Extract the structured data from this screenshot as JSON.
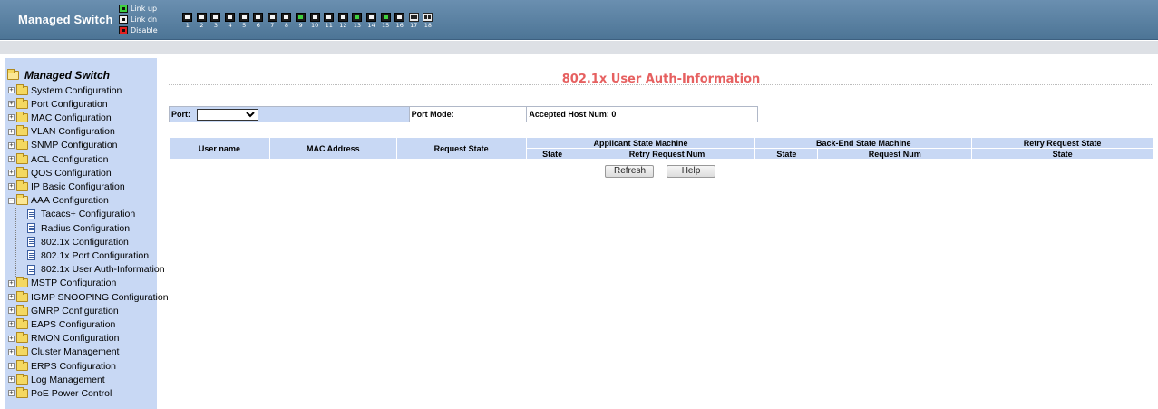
{
  "header": {
    "title": "Managed Switch",
    "legend": [
      {
        "label": "Link up",
        "icon": "port-link-up-icon"
      },
      {
        "label": "Link dn",
        "icon": "port-link-down-icon"
      },
      {
        "label": "Disable",
        "icon": "port-disabled-icon"
      }
    ],
    "ports": [
      {
        "num": "1",
        "type": "copper",
        "up": false
      },
      {
        "num": "2",
        "type": "copper",
        "up": false
      },
      {
        "num": "3",
        "type": "copper",
        "up": false
      },
      {
        "num": "4",
        "type": "copper",
        "up": false
      },
      {
        "num": "5",
        "type": "copper",
        "up": false
      },
      {
        "num": "6",
        "type": "copper",
        "up": false
      },
      {
        "num": "7",
        "type": "copper",
        "up": false
      },
      {
        "num": "8",
        "type": "copper",
        "up": false
      },
      {
        "num": "9",
        "type": "copper",
        "up": true
      },
      {
        "num": "10",
        "type": "copper",
        "up": false
      },
      {
        "num": "11",
        "type": "copper",
        "up": false
      },
      {
        "num": "12",
        "type": "copper",
        "up": false
      },
      {
        "num": "13",
        "type": "copper",
        "up": true
      },
      {
        "num": "14",
        "type": "copper",
        "up": false
      },
      {
        "num": "15",
        "type": "copper",
        "up": true
      },
      {
        "num": "16",
        "type": "copper",
        "up": false
      },
      {
        "num": "17",
        "type": "fiber",
        "up": false
      },
      {
        "num": "18",
        "type": "fiber",
        "up": false
      }
    ]
  },
  "sidebar": {
    "root": "Managed Switch",
    "items": [
      {
        "label": "System Configuration",
        "kind": "folder"
      },
      {
        "label": "Port Configuration",
        "kind": "folder"
      },
      {
        "label": "MAC Configuration",
        "kind": "folder"
      },
      {
        "label": "VLAN Configuration",
        "kind": "folder"
      },
      {
        "label": "SNMP Configuration",
        "kind": "folder"
      },
      {
        "label": "ACL Configuration",
        "kind": "folder"
      },
      {
        "label": "QOS Configuration",
        "kind": "folder"
      },
      {
        "label": "IP Basic Configuration",
        "kind": "folder"
      },
      {
        "label": "AAA Configuration",
        "kind": "folder-open"
      },
      {
        "label": "Tacacs+ Configuration",
        "kind": "page"
      },
      {
        "label": "Radius Configuration",
        "kind": "page"
      },
      {
        "label": "802.1x Configuration",
        "kind": "page"
      },
      {
        "label": "802.1x Port Configuration",
        "kind": "page"
      },
      {
        "label": "802.1x User Auth-Information",
        "kind": "page"
      },
      {
        "label": "MSTP Configuration",
        "kind": "folder"
      },
      {
        "label": "IGMP SNOOPING Configuration",
        "kind": "folder"
      },
      {
        "label": "GMRP Configuration",
        "kind": "folder"
      },
      {
        "label": "EAPS Configuration",
        "kind": "folder"
      },
      {
        "label": "RMON Configuration",
        "kind": "folder"
      },
      {
        "label": "Cluster Management",
        "kind": "folder"
      },
      {
        "label": "ERPS Configuration",
        "kind": "folder"
      },
      {
        "label": "Log Management",
        "kind": "folder"
      },
      {
        "label": "PoE Power Control",
        "kind": "folder"
      }
    ]
  },
  "main": {
    "title": "802.1x User Auth-Information",
    "title_color": "#e66060",
    "filter": {
      "port_label": "Port:",
      "port_value": "",
      "port_mode_label": "Port Mode:",
      "accepted_host_label": "Accepted Host Num: 0"
    },
    "table": {
      "user_name": "User name",
      "mac_address": "MAC Address",
      "request_state": "Request State",
      "applicant_group": "Applicant State Machine",
      "backend_group": "Back-End State Machine",
      "retry_group": "Retry Request State",
      "applicant_state": "State",
      "applicant_retry": "Retry Request Num",
      "backend_state": "State",
      "backend_request": "Request Num",
      "retry_state": "State"
    },
    "buttons": {
      "refresh": "Refresh",
      "help": "Help"
    }
  },
  "colors": {
    "header_bg": "#5a82a4",
    "sidebar_bg": "#c8d8f4",
    "table_header_bg": "#c8d8f4",
    "link_up": "#3fd040"
  }
}
